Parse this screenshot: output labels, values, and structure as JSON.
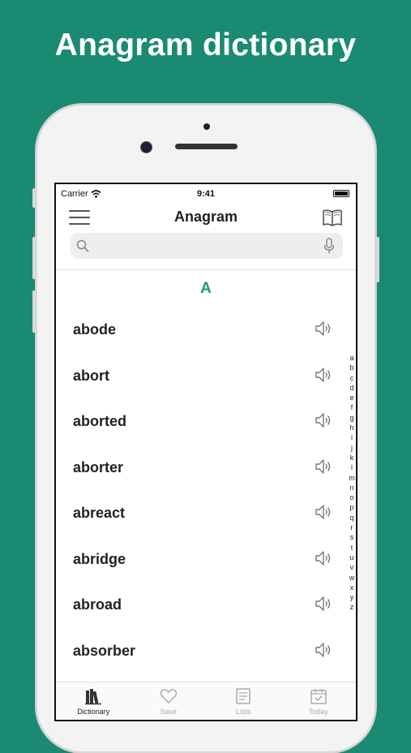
{
  "banner": {
    "title": "Anagram dictionary"
  },
  "status": {
    "carrier": "Carrier",
    "time": "9:41"
  },
  "nav": {
    "title": "Anagram",
    "left_icon": "menu-icon",
    "right_icon": "book-icon"
  },
  "search": {
    "placeholder": "",
    "value": ""
  },
  "section": {
    "letter": "A"
  },
  "words": [
    "abode",
    "abort",
    "aborted",
    "aborter",
    "abreact",
    "abridge",
    "abroad",
    "absorber"
  ],
  "index": [
    "a",
    "b",
    "c",
    "d",
    "e",
    "f",
    "g",
    "h",
    "i",
    "j",
    "k",
    "l",
    "m",
    "n",
    "o",
    "p",
    "q",
    "r",
    "s",
    "t",
    "u",
    "v",
    "w",
    "x",
    "y",
    "z"
  ],
  "tabs": [
    {
      "label": "Dictionary",
      "icon": "books-icon",
      "active": true
    },
    {
      "label": "Save",
      "icon": "heart-icon",
      "active": false
    },
    {
      "label": "Lists",
      "icon": "list-icon",
      "active": false
    },
    {
      "label": "Today",
      "icon": "calendar-icon",
      "active": false
    }
  ],
  "colors": {
    "background": "#1a8a72",
    "accent": "#1a9a78"
  }
}
